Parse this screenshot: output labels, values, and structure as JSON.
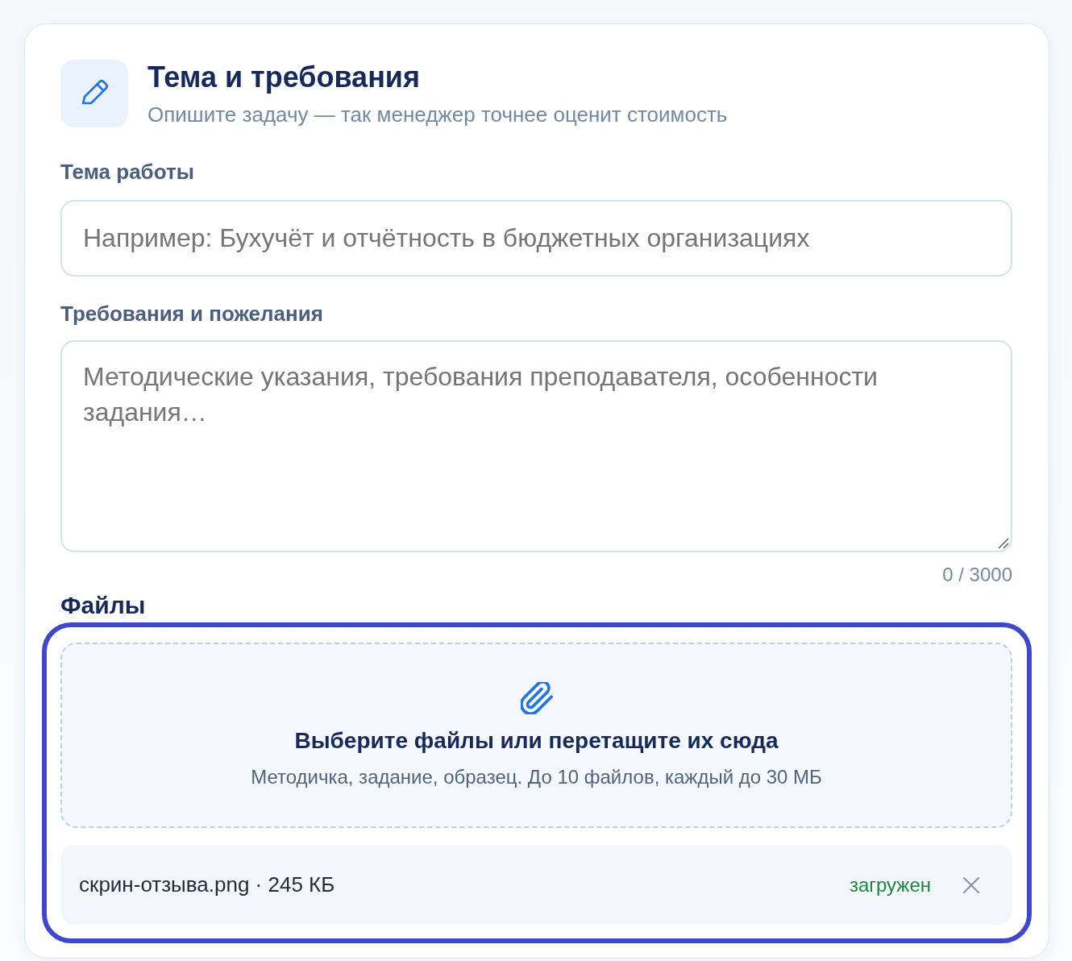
{
  "header": {
    "title": "Тема и требования",
    "subtitle": "Опишите задачу — так менеджер точнее оценит стоимость"
  },
  "topic": {
    "label": "Тема работы",
    "placeholder": "Например: Бухучёт и отчётность в бюджетных организациях"
  },
  "requirements": {
    "label": "Требования и пожелания",
    "placeholder": "Методические указания, требования преподавателя, особенности задания…",
    "counter": "0 / 3000"
  },
  "files": {
    "label": "Файлы",
    "focused": true,
    "dropzone": {
      "title": "Выберите файлы или перетащите их сюда",
      "hint": "Методичка, задание, образец. До 10 файлов, каждый до 30 МБ"
    },
    "items": [
      {
        "name": "скрин-отзыва.png · 245 КБ",
        "status": "загружен",
        "uploaded": true
      }
    ]
  }
}
